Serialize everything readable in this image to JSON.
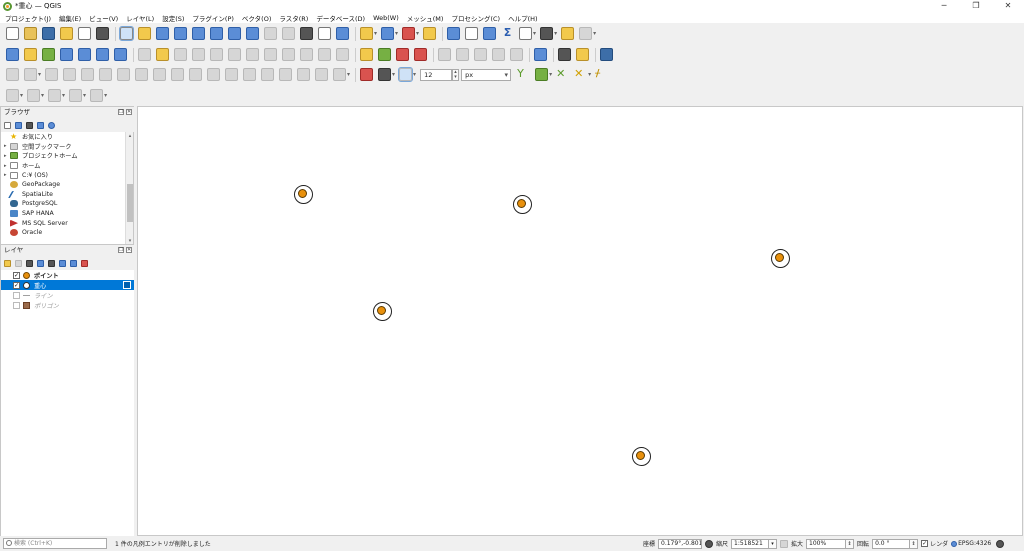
{
  "window": {
    "title": "*重心 — QGIS",
    "minimize": "─",
    "maximize": "❐",
    "close": "✕"
  },
  "menu": [
    "プロジェクト(J)",
    "編集(E)",
    "ビュー(V)",
    "レイヤ(L)",
    "設定(S)",
    "プラグイン(P)",
    "ベクタ(O)",
    "ラスタ(R)",
    "データベース(D)",
    "Web(W)",
    "メッシュ(M)",
    "プロセシング(C)",
    "ヘルプ(H)"
  ],
  "toolbar": {
    "snap_tolerance": "12",
    "snap_unit": "px"
  },
  "browser": {
    "title": "ブラウザ",
    "items": [
      {
        "label": "お気に入り",
        "icon": "star-icon",
        "expandable": false
      },
      {
        "label": "空間ブックマーク",
        "icon": "bookmark-icon",
        "expandable": true
      },
      {
        "label": "プロジェクトホーム",
        "icon": "project-home-icon",
        "expandable": true
      },
      {
        "label": "ホーム",
        "icon": "home-icon",
        "expandable": true
      },
      {
        "label": "C:¥ (OS)",
        "icon": "drive-icon",
        "expandable": true
      },
      {
        "label": "GeoPackage",
        "icon": "geopackage-icon",
        "expandable": false
      },
      {
        "label": "SpatiaLite",
        "icon": "spatialite-icon",
        "expandable": false
      },
      {
        "label": "PostgreSQL",
        "icon": "postgresql-icon",
        "expandable": false
      },
      {
        "label": "SAP HANA",
        "icon": "sap-hana-icon",
        "expandable": false
      },
      {
        "label": "MS SQL Server",
        "icon": "mssql-icon",
        "expandable": false
      },
      {
        "label": "Oracle",
        "icon": "oracle-icon",
        "expandable": false
      }
    ]
  },
  "layers": {
    "title": "レイヤ",
    "items": [
      {
        "label": "ポイント",
        "checked": true,
        "selected": false,
        "symbol": "point",
        "bold": true
      },
      {
        "label": "重心",
        "checked": true,
        "selected": true,
        "symbol": "white-point",
        "bold": false
      },
      {
        "label": "ライン",
        "checked": false,
        "selected": false,
        "symbol": "line",
        "bold": false
      },
      {
        "label": "ポリゴン",
        "checked": false,
        "selected": false,
        "symbol": "polygon",
        "bold": false
      }
    ]
  },
  "map": {
    "background": "#ffffff",
    "symbol_fill": "#e8900c"
  },
  "status": {
    "locator_placeholder": "検索 (Ctrl+K)",
    "message": "1 件の凡例エントリが削除しました",
    "coord_label": "座標",
    "coord_value": "0.179°,-0.801°",
    "scale_label": "縮尺",
    "scale_value": "1:518521",
    "magnifier_label": "拡大",
    "magnifier_value": "100%",
    "rotation_label": "回転",
    "rotation_value": "0.0 °",
    "render_label": "レンダ",
    "crs": "EPSG:4326"
  }
}
